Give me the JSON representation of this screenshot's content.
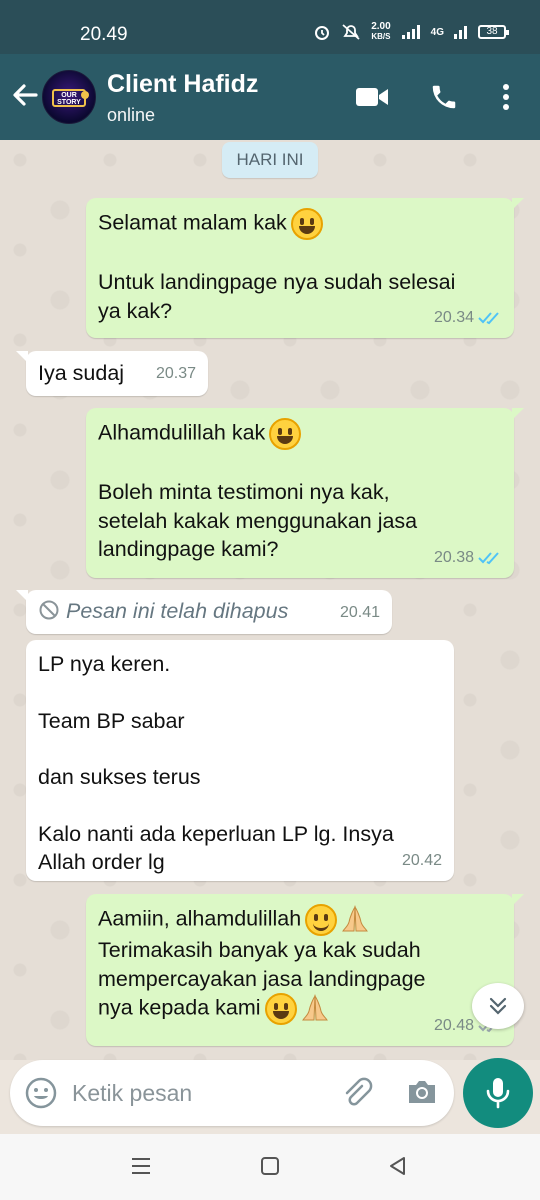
{
  "status_bar": {
    "time": "20.49",
    "speed_value": "2.00",
    "speed_unit": "KB/S",
    "network": "4G",
    "battery": "38"
  },
  "header": {
    "contact_name": "Client Hafidz",
    "status": "online",
    "avatar_text": "OUR STORY"
  },
  "date_separator": "HARI INI",
  "messages": [
    {
      "dir": "out",
      "lines": [
        "Selamat malam kak",
        "",
        "Untuk landingpage nya sudah selesai",
        "ya kak?"
      ],
      "time": "20.34",
      "read": true
    },
    {
      "dir": "in",
      "lines": [
        "Iya sudaj"
      ],
      "time": "20.37"
    },
    {
      "dir": "out",
      "lines": [
        "Alhamdulillah kak",
        "",
        "Boleh minta testimoni nya kak,",
        "setelah kakak menggunakan jasa",
        "landingpage kami?"
      ],
      "time": "20.38",
      "read": true
    },
    {
      "dir": "in",
      "deleted": true,
      "lines": [
        "Pesan ini telah dihapus"
      ],
      "time": "20.41"
    },
    {
      "dir": "in",
      "lines": [
        "LP nya keren.",
        "",
        "Team BP sabar",
        "",
        "dan sukses terus",
        "",
        "Kalo nanti ada keperluan LP lg. Insya",
        "Allah order lg"
      ],
      "time": "20.42"
    },
    {
      "dir": "out",
      "lines": [
        "Aamiin, alhamdulillah",
        "Terimakasih banyak ya kak sudah",
        "mempercayakan jasa landingpage",
        "nya kepada kami"
      ],
      "time": "20.48",
      "read": true
    }
  ],
  "composer": {
    "placeholder": "Ketik pesan"
  },
  "colors": {
    "header": "#2b5a66",
    "status_bar": "#2b4e58",
    "outgoing": "#dcf8c6",
    "incoming": "#ffffff",
    "mic": "#128c7e",
    "read_ticks": "#4fc3f7"
  },
  "icons": [
    "back-arrow-icon",
    "video-call-icon",
    "phone-icon",
    "more-vert-icon",
    "emoji-icon",
    "attach-icon",
    "camera-icon",
    "mic-icon",
    "scroll-down-icon",
    "blocked-icon",
    "double-check-icon",
    "menu-icon",
    "home-icon",
    "back-nav-icon"
  ]
}
